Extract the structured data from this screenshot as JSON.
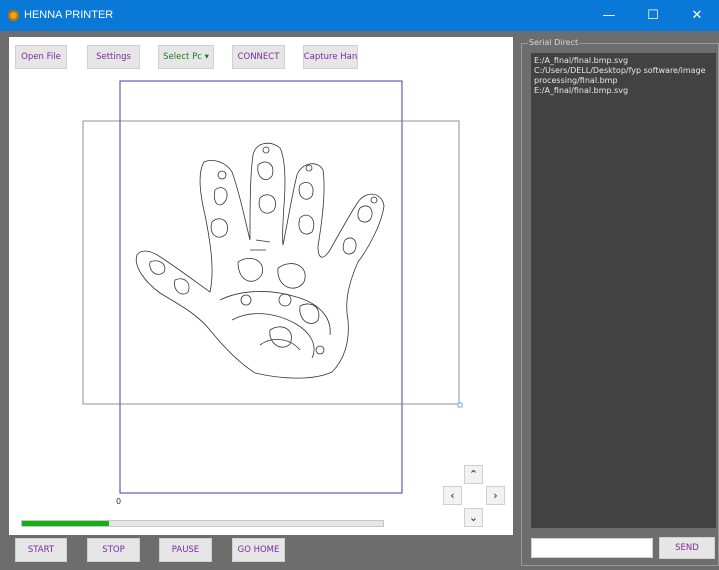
{
  "window": {
    "title": "HENNA PRINTER",
    "controls": {
      "minimize": "—",
      "maximize": "☐",
      "close": "✕"
    }
  },
  "toolbar": {
    "open_file": "Open File",
    "settings": "Settings",
    "select_port": "Select Pc ▾",
    "connect": "CONNECT",
    "capture_hand": "Capture Han"
  },
  "canvas": {
    "origin_label": "0",
    "progress_fraction": 0.24
  },
  "jog": {
    "up": "⌃",
    "left": "‹",
    "right": "›",
    "down": "⌄"
  },
  "bottom_buttons": {
    "start": "START",
    "stop": "STOP",
    "pause": "PAUSE",
    "go_home": "GO HOME"
  },
  "serial": {
    "title": "Serial Direct",
    "lines": [
      "E:/A_final/final.bmp.svg",
      "C:/Users/DELL/Desktop/fyp software/image",
      "processing/final.bmp",
      "E:/A_final/final.bmp.svg"
    ],
    "input_value": "",
    "send": "SEND"
  },
  "colors": {
    "titlebar": "#0a78d7",
    "progress": "#13b013",
    "button_text": "#7b2aa0"
  }
}
